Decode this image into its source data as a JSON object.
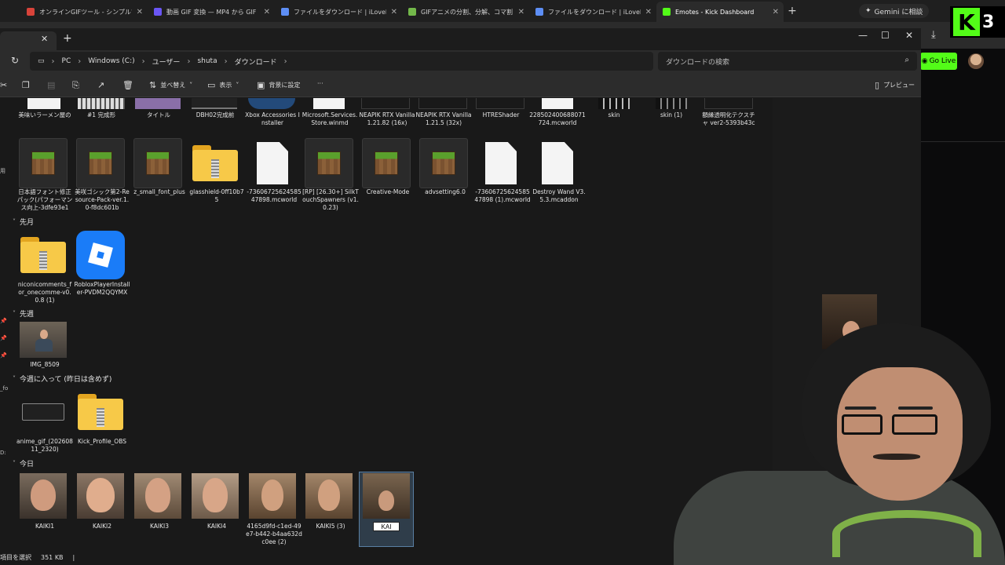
{
  "browser": {
    "tabs": [
      {
        "title": "オンラインGIFツール - シンプルで無料",
        "color": "#d8433a",
        "active": false
      },
      {
        "title": "動画 GIF 変換 — MP4 から GIF",
        "color": "#6a56f5",
        "active": false
      },
      {
        "title": "ファイルをダウンロード | iLoveIMG",
        "color": "#5d8ef5",
        "active": false
      },
      {
        "title": "GIFアニメの分割、分解、コマ割り",
        "color": "#73b84a",
        "active": false
      },
      {
        "title": "ファイルをダウンロード | iLoveIMG",
        "color": "#5d8ef5",
        "active": false
      },
      {
        "title": "Emotes - Kick Dashboard",
        "color": "#53fc18",
        "active": true
      }
    ],
    "gemini_label": "Gemini に相談",
    "go_live_label": "Go Live",
    "kick_letter": "K",
    "kick_number": "3"
  },
  "explorer": {
    "address": [
      "PC",
      "Windows (C:)",
      "ユーザー",
      "shuta",
      "ダウンロード"
    ],
    "search_placeholder": "ダウンロードの検索",
    "toolbar": {
      "sort_label": "並べ替え",
      "view_label": "表示",
      "wallpaper_label": "背景に設定",
      "more_label": "···",
      "preview_label": "プレビュー"
    },
    "row0_captions": [
      "美味いラーメン屋の",
      "#1 完成形",
      "タイトル",
      "DBH02完成前",
      "Xbox Accessories Installer",
      "Microsoft.Services.Store.winmd",
      "NEAPIK RTX Vanilla 1.21.82 (16x)",
      "NEAPIK RTX Vanilla 1.21.5 (32x)",
      "HTREShader",
      "228502400688071724.mcworld",
      "skin",
      "skin (1)",
      "額縁透明化テクスチャ ver2-5393b43c"
    ],
    "row1_captions": [
      "日本語フォント修正パック(パフォーマンス向上-3dfe93e1",
      "美咲ゴシック第2-Resource-Pack-ver.1.0-f8dc601b",
      "z_small_font_plus",
      "glasshield-0ff10b75",
      "-7360672562458547898.mcworld",
      "[RP] [26.30+] SilkTouchSpawners (v1.0.23)",
      "Creative-Mode",
      "advsetting6.0",
      "-7360672562458547898 (1).mcworld",
      "Destroy Wand V3.5.3.mcaddon"
    ],
    "groups": {
      "last_month": "先月",
      "last_week": "先週",
      "this_week": "今週に入って (昨日は含めず)",
      "today": "今日"
    },
    "last_month_items": [
      "niconicomments_for_onecomme-v0.0.8 (1)",
      "RobloxPlayerInstaller-PVDM2QQYMX"
    ],
    "last_week_items": [
      "IMG_8509"
    ],
    "this_week_items": [
      "anime_gif_(20260811_2320)",
      "Kick_Profile_OBS"
    ],
    "today_items": [
      "KAIKI1",
      "KAIKI2",
      "KAIKI3",
      "KAIKI4",
      "4165d9fd-c1ed-49e7-b442-b4aa632dc0ee (2)",
      "KAIKI5 (3)"
    ],
    "rename_value": "KAI",
    "status": {
      "selected": "項目を選択",
      "size": "351 KB"
    }
  }
}
